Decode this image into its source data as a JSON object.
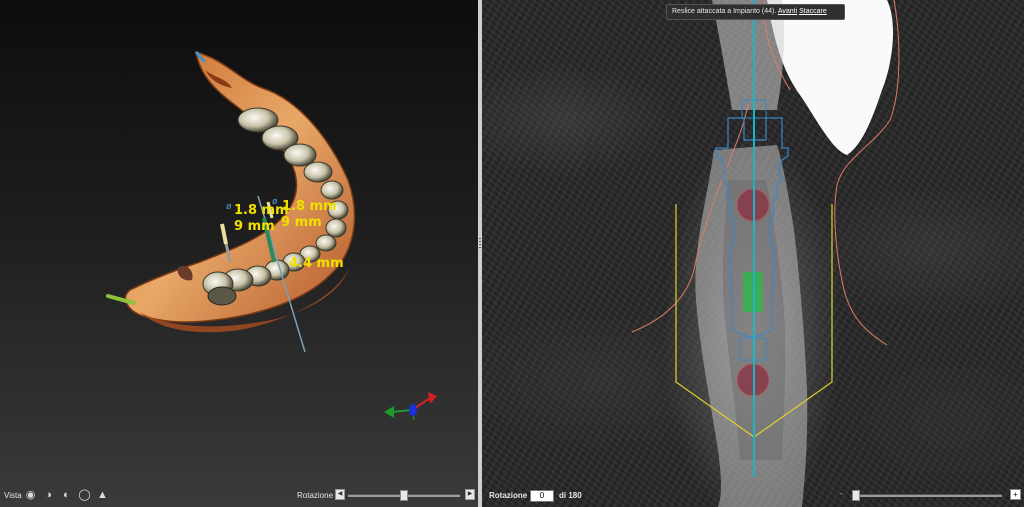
{
  "left_view": {
    "measurements": {
      "diameter_1": "1.8 mm",
      "length_1": "9 mm",
      "diameter_2": "1.8 mm",
      "length_2": "9 mm",
      "distance": "4.4 mm"
    },
    "diameter_symbol": "ø",
    "axis_colors": {
      "x": "#d42020",
      "y": "#1f9a2a",
      "z": "#1a2fd8"
    },
    "toolbar": {
      "vista_label": "Vista",
      "view_icons": [
        "skull-front-icon",
        "skull-side-icon",
        "skull-back-icon",
        "skull-top-icon",
        "skull-bottom-icon"
      ],
      "rotation_label": "Rotazione",
      "slider_level": 0.5
    }
  },
  "right_view": {
    "banner": {
      "text": "Reslice attaccata a Impianto (44).",
      "next_link": "Avanti",
      "detach_link": "Staccare"
    },
    "toolbar": {
      "rotation_label": "Rotazione",
      "rotation_value": "0",
      "rotation_of": "di 180",
      "minus": "-",
      "plus": "+",
      "slider_level": 0.0
    },
    "colors": {
      "nerve_line": "#19b5c8",
      "implant_outline": "#3a86c8",
      "safety_zone": "#e0d030",
      "soft_tissue": "#e07a6a"
    }
  }
}
